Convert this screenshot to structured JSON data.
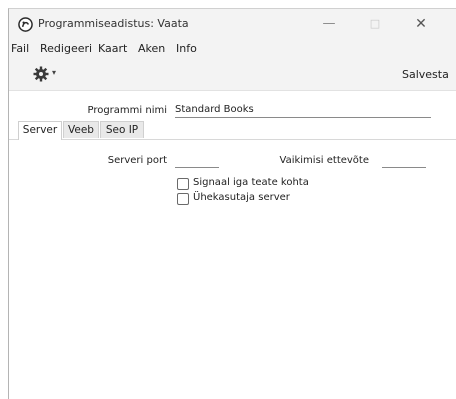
{
  "window": {
    "title": "Programmiseadistus: Vaata",
    "controls": {
      "minimize": "—",
      "maximize": "□",
      "close": "✕"
    }
  },
  "menu": [
    "Fail",
    "Redigeeri",
    "Kaart",
    "Aken",
    "Info"
  ],
  "toolbar": {
    "gear_icon": "gear-icon",
    "caret": "▾",
    "save_label": "Salvesta"
  },
  "form": {
    "program_name_label": "Programmi nimi",
    "program_name_value": "Standard Books"
  },
  "tabs": [
    "Server",
    "Veeb",
    "Seo IP"
  ],
  "active_tab": "Server",
  "server": {
    "port_label": "Serveri port",
    "port_value": "",
    "default_company_label": "Vaikimisi ettevõte",
    "default_company_value": "",
    "checkboxes": [
      {
        "label": "Signaal iga teate kohta",
        "checked": false
      },
      {
        "label": "Ühekasutaja server",
        "checked": false
      }
    ]
  },
  "colors": {
    "chrome": "#f3f3f3",
    "tab_inactive": "#e9e9e9"
  }
}
